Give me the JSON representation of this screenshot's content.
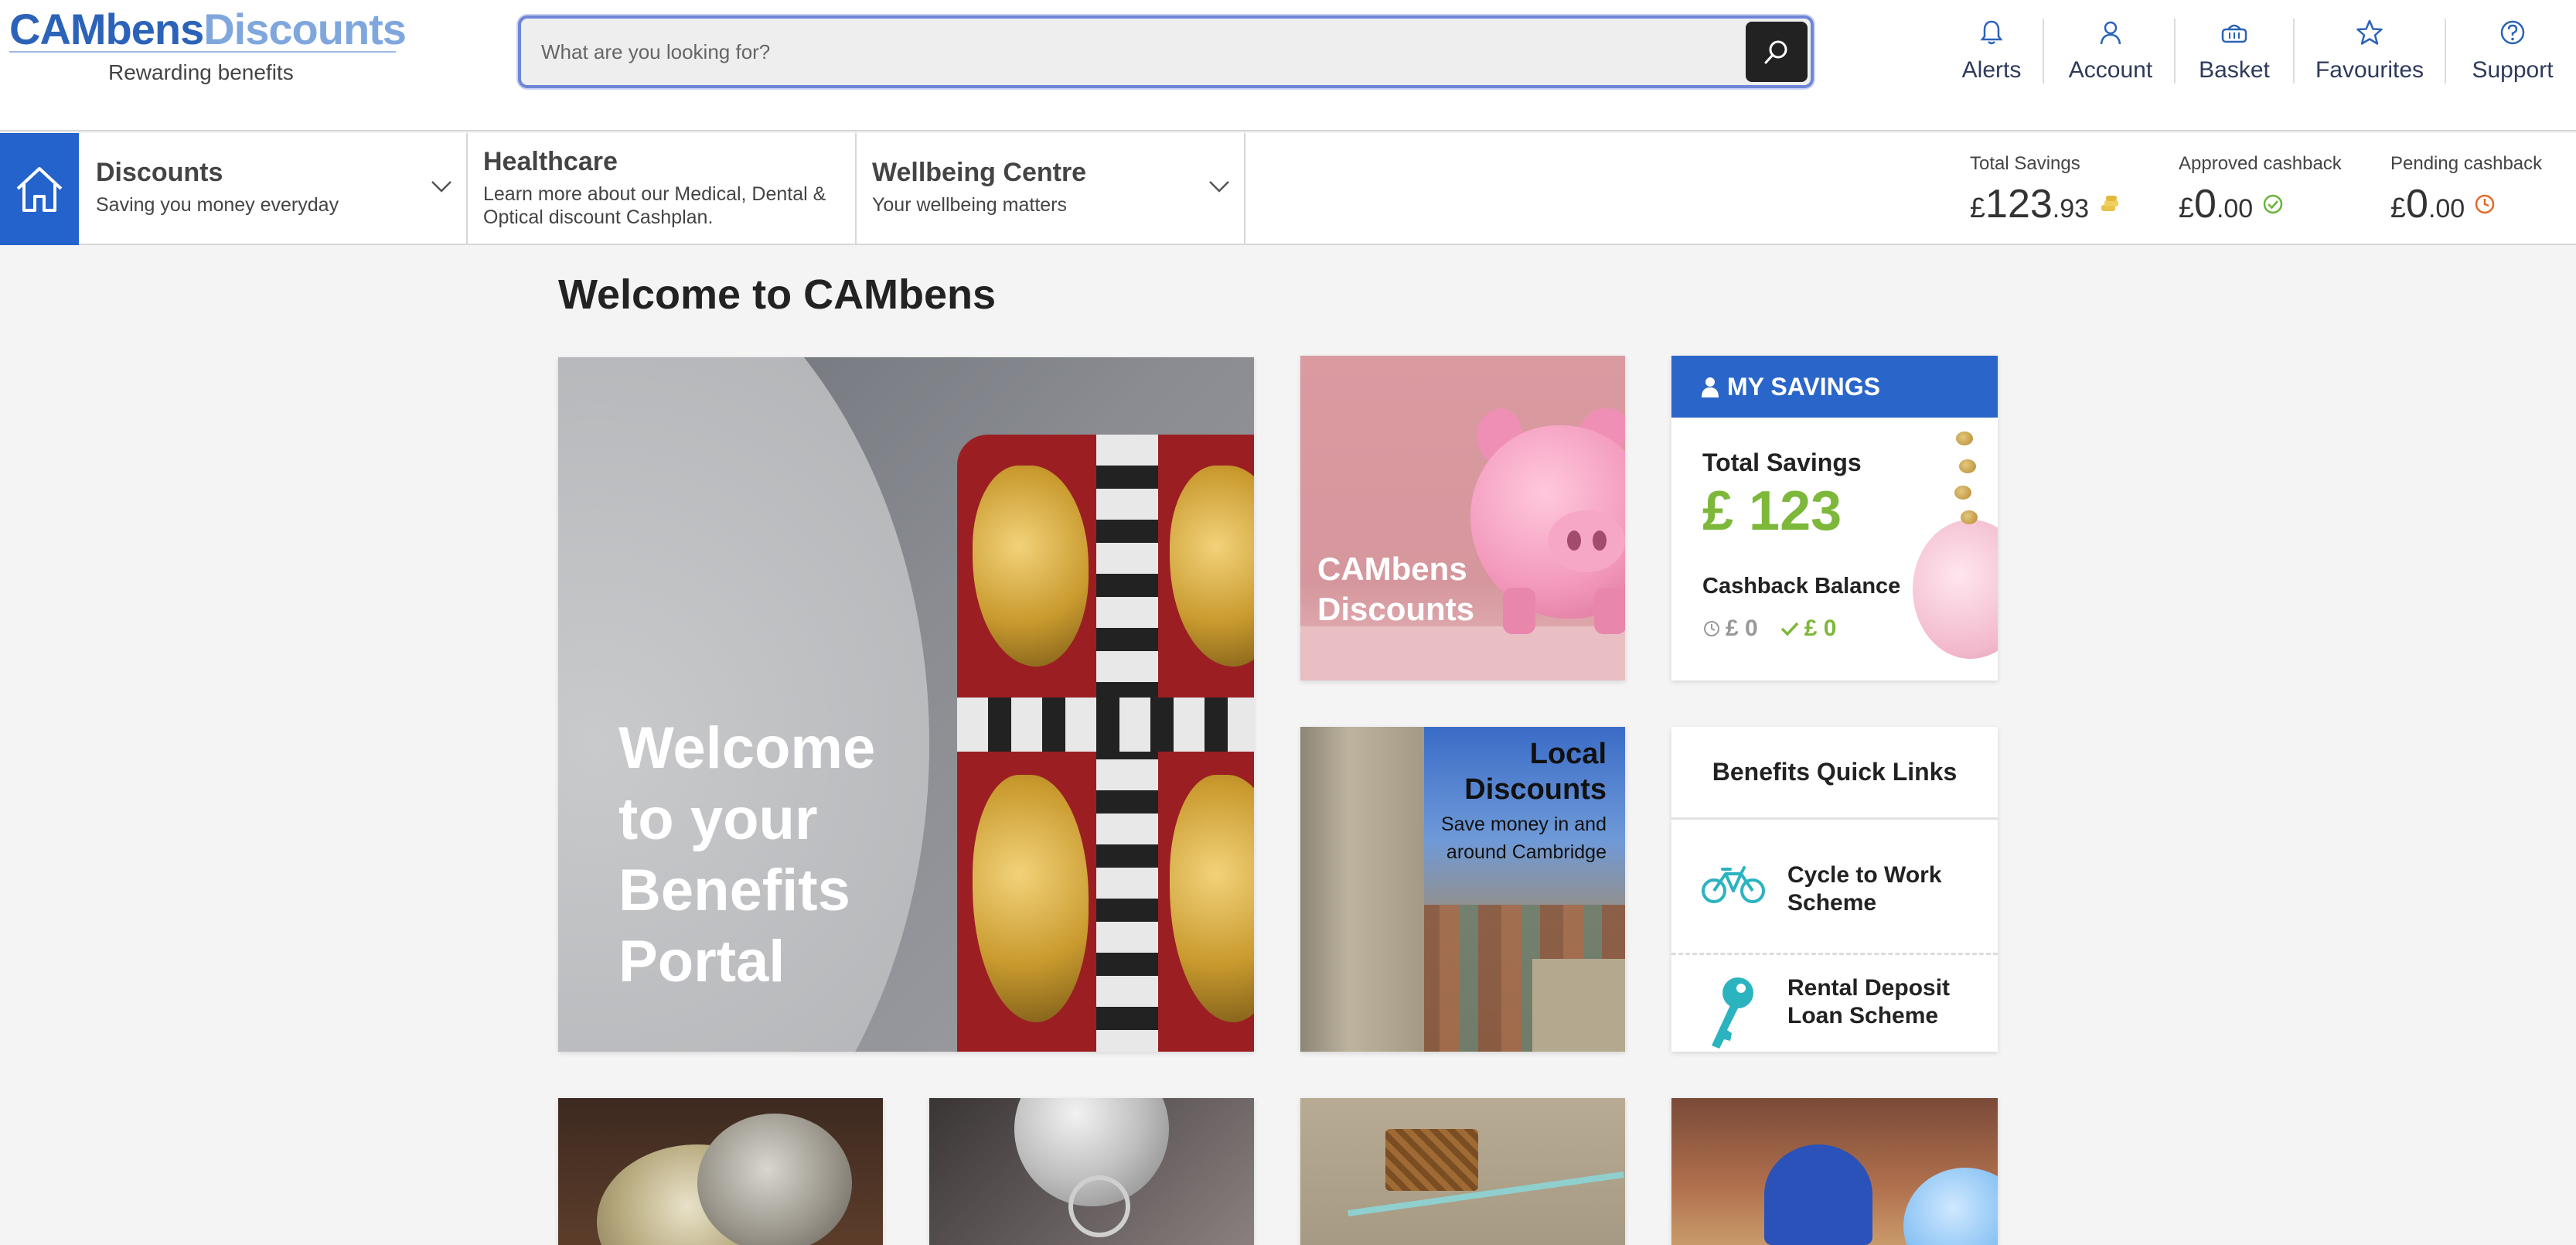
{
  "brand": {
    "logo_part1": "CAMbens",
    "logo_part2": "Discounts",
    "tagline": "Rewarding benefits",
    "colors": {
      "primary": "#2b63b8",
      "secondary": "#7fa7de",
      "accent_blue": "#2463cc",
      "savings_green": "#7db83a",
      "pending_orange": "#e06a2b"
    }
  },
  "search": {
    "placeholder": "What are you looking for?",
    "icon": "search-icon"
  },
  "top_nav": [
    {
      "label": "Alerts",
      "icon": "bell-icon"
    },
    {
      "label": "Account",
      "icon": "user-icon"
    },
    {
      "label": "Basket",
      "icon": "basket-icon"
    },
    {
      "label": "Favourites",
      "icon": "star-icon"
    },
    {
      "label": "Support",
      "icon": "help-icon"
    }
  ],
  "menu": {
    "home_icon": "home-icon",
    "items": [
      {
        "title": "Discounts",
        "subtitle": "Saving you money everyday",
        "has_dropdown": true
      },
      {
        "title": "Healthcare",
        "subtitle": "Learn more about our Medical, Dental & Optical discount Cashplan.",
        "has_dropdown": false
      },
      {
        "title": "Wellbeing Centre",
        "subtitle": "Your wellbeing matters",
        "has_dropdown": true
      }
    ]
  },
  "stats": {
    "total_savings": {
      "label": "Total Savings",
      "currency": "£",
      "whole": "123",
      "decimal": ".93",
      "icon": "coins-icon"
    },
    "approved_cashback": {
      "label": "Approved cashback",
      "currency": "£",
      "whole": "0",
      "decimal": ".00",
      "icon": "check-circle-icon"
    },
    "pending_cashback": {
      "label": "Pending cashback",
      "currency": "£",
      "whole": "0",
      "decimal": ".00",
      "icon": "clock-icon"
    }
  },
  "main": {
    "title": "Welcome to CAMbens",
    "hero_text": "Welcome to your Benefits Portal",
    "discounts_card": {
      "title_line1": "CAMbens",
      "title_line2": "Discounts"
    },
    "my_savings": {
      "header": "MY SAVINGS",
      "total_label": "Total Savings",
      "total_value": "£ 123",
      "cashback_label": "Cashback Balance",
      "pending": "£ 0",
      "approved": "£ 0"
    },
    "local_discounts": {
      "title_line1": "Local",
      "title_line2": "Discounts",
      "subtitle_line1": "Save money in and",
      "subtitle_line2": "around Cambridge"
    },
    "quick_links": {
      "title": "Benefits Quick Links",
      "items": [
        {
          "line1": "Cycle to Work",
          "line2": "Scheme",
          "icon": "bicycle-icon"
        },
        {
          "line1": "Rental Deposit",
          "line2": "Loan Scheme",
          "icon": "key-icon"
        }
      ]
    }
  }
}
